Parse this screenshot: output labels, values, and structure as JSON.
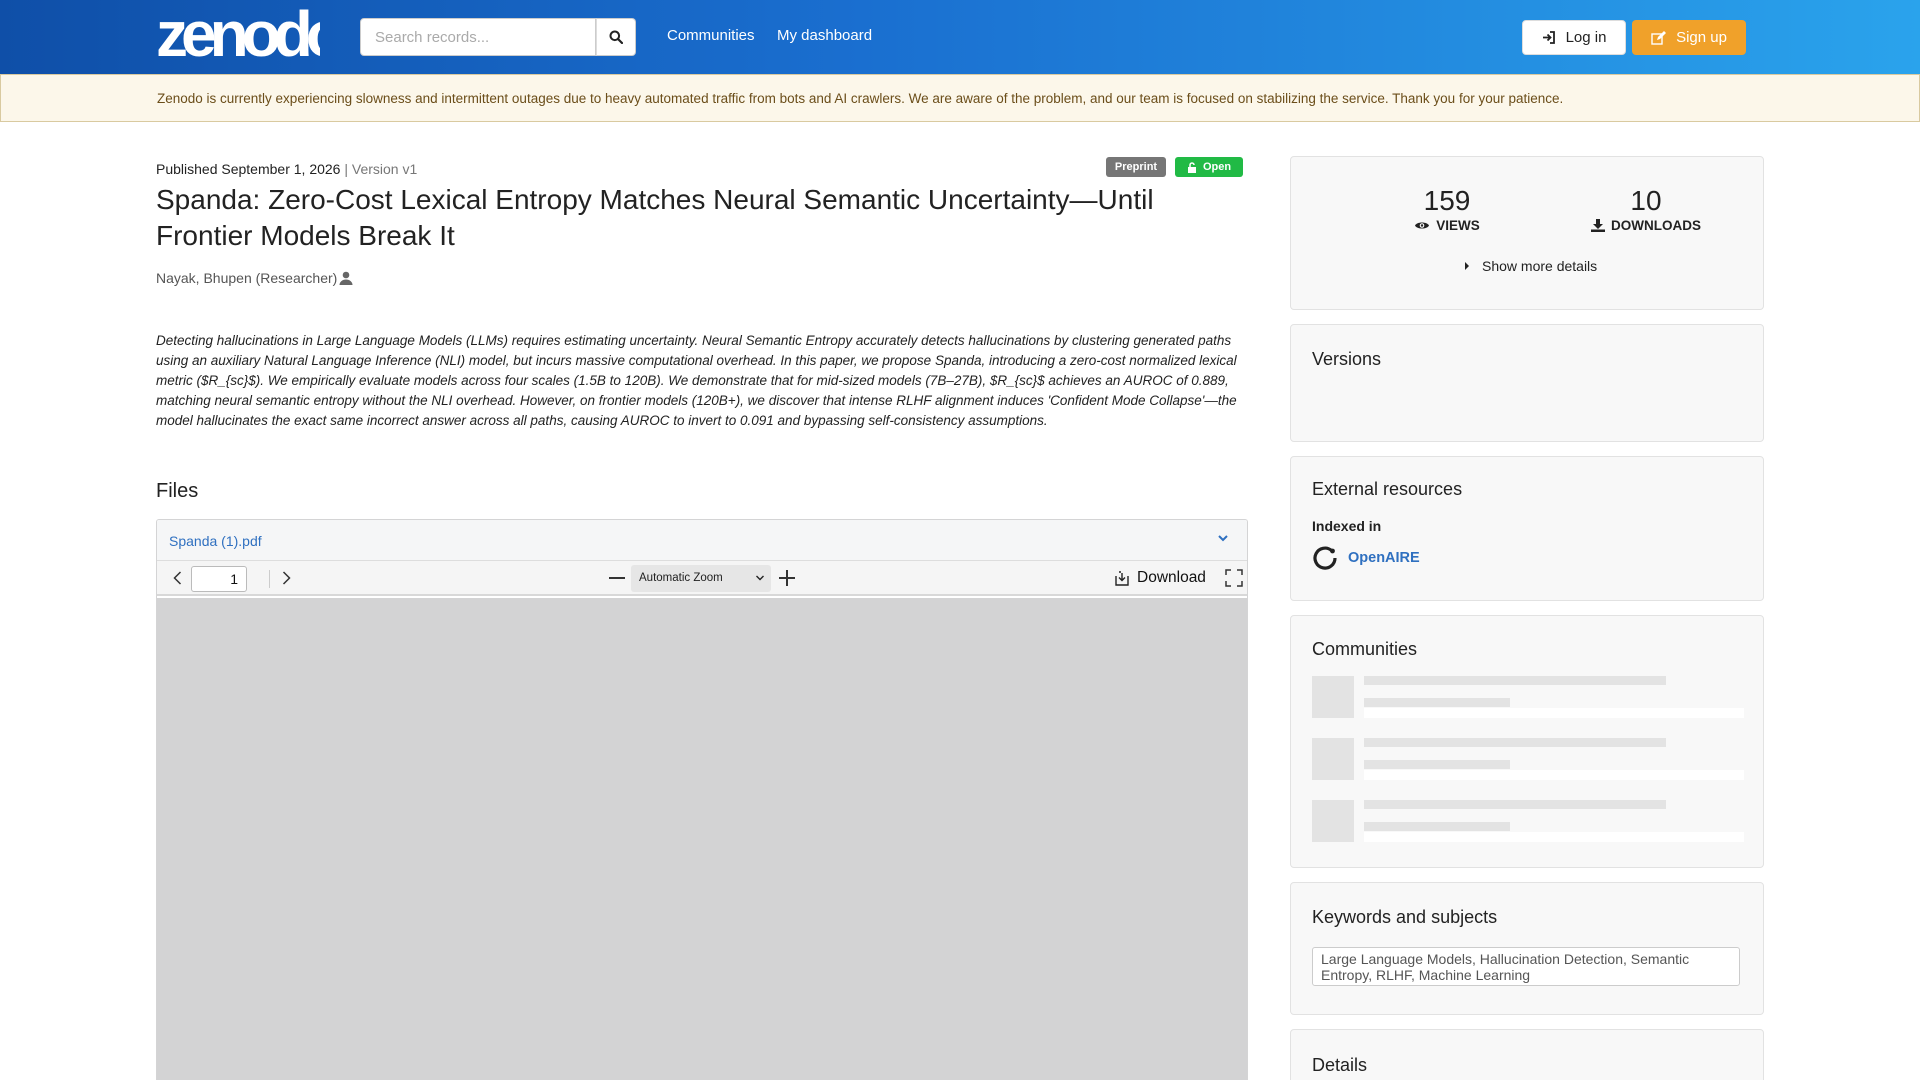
{
  "header": {
    "logo_text": "zenodo",
    "search": {
      "placeholder": "Search records...",
      "value": ""
    },
    "nav": [
      {
        "label": "Communities"
      },
      {
        "label": "My dashboard"
      }
    ],
    "login_label": "Log in",
    "signup_label": "Sign up",
    "colors": {
      "gradient_start": "#0f4fa8",
      "gradient_end": "#2aa3ec",
      "signup": "#f0a12a"
    }
  },
  "banner": {
    "text": "Zenodo is currently experiencing slowness and intermittent outages due to heavy automated traffic from bots and AI crawlers. We are aware of the problem, and our team is focused on stabilizing the service. Thank you for your patience."
  },
  "record": {
    "published": "Published September 1, 2026",
    "separator": " | ",
    "version": "Version v1",
    "badges": {
      "preprint": "Preprint",
      "open": "Open"
    },
    "title": "Spanda: Zero-Cost Lexical Entropy Matches Neural Semantic Uncertainty—Until Frontier Models Break It",
    "author": "Nayak, Bhupen (Researcher)",
    "abstract": "Detecting hallucinations in Large Language Models (LLMs) requires estimating uncertainty. Neural Semantic Entropy accurately detects hallucinations by clustering generated paths using an auxiliary Natural Language Inference (NLI) model, but incurs massive computational overhead. In this paper, we propose Spanda, introducing a zero-cost normalized lexical metric ($R_{sc}$). We empirically evaluate models across four scales (1.5B to 120B). We demonstrate that for mid-sized models (7B–27B), $R_{sc}$ achieves an AUROC of 0.889, matching neural semantic entropy without the NLI overhead. However, on frontier models (120B+), we discover that intense RLHF alignment induces 'Confident Mode Collapse'—the model hallucinates the exact same incorrect answer across all paths, causing AUROC to invert to 0.091 and bypassing self-consistency assumptions."
  },
  "files": {
    "heading": "Files",
    "file_name": "Spanda (1).pdf",
    "viewer": {
      "page": "1",
      "zoom": "Automatic Zoom",
      "download_label": "Download"
    }
  },
  "sidebar": {
    "stats": {
      "views": "159",
      "views_label": "VIEWS",
      "downloads": "10",
      "downloads_label": "DOWNLOADS",
      "show_more": "Show more details"
    },
    "versions_title": "Versions",
    "external_title": "External resources",
    "indexed_in": "Indexed in",
    "openaire": "OpenAIRE",
    "communities_title": "Communities",
    "keywords_title": "Keywords and subjects",
    "keywords": "Large Language Models, Hallucination Detection, Semantic Entropy, RLHF, Machine Learning",
    "details_title": "Details"
  }
}
